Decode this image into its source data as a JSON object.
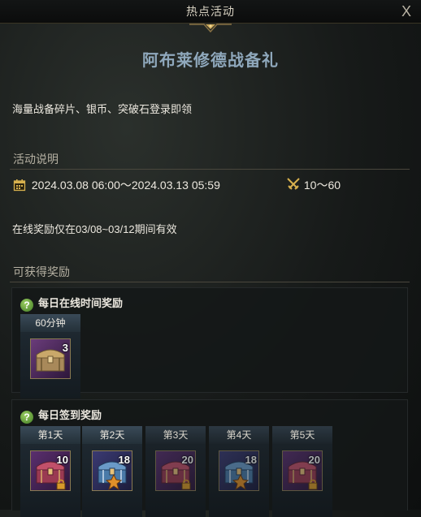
{
  "window": {
    "title": "热点活动",
    "close_label": "X"
  },
  "event": {
    "title": "阿布莱修德战备礼",
    "summary": "海量战备碎片、银币、突破石登录即领"
  },
  "description": {
    "heading": "活动说明",
    "date_range": "2024.03.08 06:00～2024.03.13 05:59",
    "level_range": "10～60",
    "note": "在线奖励仅在03/08~03/12期间有效"
  },
  "rewards": {
    "heading": "可获得奖励",
    "help_icon": "?",
    "online": {
      "title": "每日在线时间奖励",
      "columns": [
        {
          "label": "60分钟",
          "count": "3"
        }
      ]
    },
    "checkin": {
      "title": "每日签到奖励",
      "columns": [
        {
          "label": "第1天",
          "count": "10"
        },
        {
          "label": "第2天",
          "count": "18"
        },
        {
          "label": "第3天",
          "count": "20"
        },
        {
          "label": "第4天",
          "count": "18"
        },
        {
          "label": "第5天",
          "count": "20"
        }
      ]
    }
  },
  "icons": {
    "calendar": "calendar-icon",
    "level": "crossed-swords-icon",
    "chest": "treasure-chest-icon",
    "help": "question-icon"
  },
  "colors": {
    "title_blue": "#8fa8bc",
    "gold": "#c9a75a",
    "help_green": "#6aa83a"
  }
}
